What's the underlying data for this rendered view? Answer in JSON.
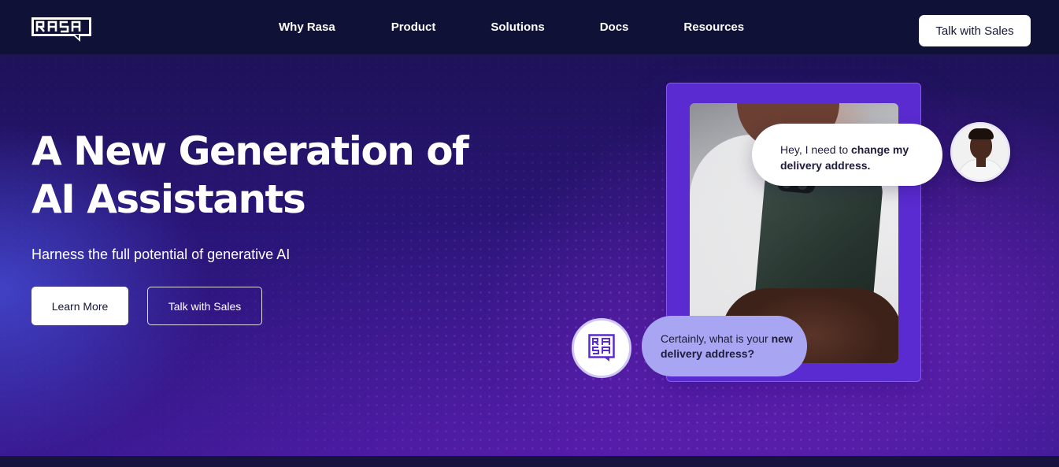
{
  "brand": {
    "logo_text": "RASA"
  },
  "nav": {
    "links": [
      "Why Rasa",
      "Product",
      "Solutions",
      "Docs",
      "Resources"
    ],
    "cta_label": "Talk with Sales"
  },
  "hero": {
    "headline_line1": "A New Generation of",
    "headline_line2": "AI Assistants",
    "subheadline": "Harness the full potential of generative AI",
    "primary_button": "Learn More",
    "secondary_button": "Talk with Sales"
  },
  "chat": {
    "user_message_plain": "Hey, I need to ",
    "user_message_bold": "change my delivery address.",
    "bot_message_plain": "Certainly, what is your ",
    "bot_message_bold": "new delivery address?",
    "bot_avatar_logo_text": "RASA"
  },
  "colors": {
    "nav_bg": "#0f1137",
    "hero_purple": "#3a1a93",
    "frame_purple": "#5a2bd0",
    "bot_bubble": "#a8a6f2",
    "text_dark": "#14143a"
  },
  "icons": {
    "logo": "rasa-logo-icon",
    "bot_avatar": "rasa-bot-avatar-icon",
    "user_avatar": "user-avatar-photo"
  }
}
